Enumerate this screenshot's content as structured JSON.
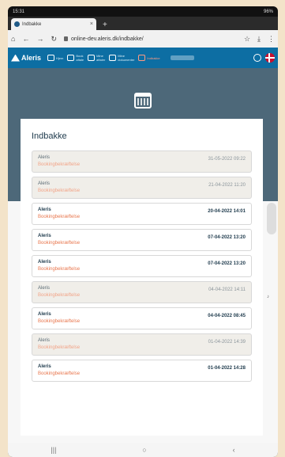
{
  "status": {
    "time": "15:31",
    "right": "96%"
  },
  "browser": {
    "tab_title": "Indbakke",
    "close": "×",
    "new_tab": "+",
    "url": "online-dev.aleris.dk/indbakke/"
  },
  "nav": {
    "logo": "Aleris",
    "items": [
      {
        "label": "Hjem",
        "icon": "heart-icon"
      },
      {
        "label": "Book\naftale",
        "icon": "calendar-icon"
      },
      {
        "label": "Mine\naftaler",
        "icon": "checklist-icon"
      },
      {
        "label": "Mine\ndokumenter",
        "icon": "document-icon"
      },
      {
        "label": "Indbakke",
        "icon": "mail-icon",
        "active": true
      }
    ]
  },
  "inbox": {
    "title": "Indbakke",
    "messages": [
      {
        "sender": "Aleris",
        "subject": "Bookingbekræftelse",
        "date": "31-05-2022 09:22",
        "read": true
      },
      {
        "sender": "Aleris",
        "subject": "Bookingbekræftelse",
        "date": "21-04-2022 11:20",
        "read": true
      },
      {
        "sender": "Aleris",
        "subject": "Bookingbekræftelse",
        "date": "20-04-2022 14:01",
        "read": false
      },
      {
        "sender": "Aleris",
        "subject": "Bookingbekræftelse",
        "date": "07-04-2022 13:20",
        "read": false
      },
      {
        "sender": "Aleris",
        "subject": "Bookingbekræftelse",
        "date": "07-04-2022 13:20",
        "read": false
      },
      {
        "sender": "Aleris",
        "subject": "Bookingbekræftelse",
        "date": "04-04-2022 14:11",
        "read": true
      },
      {
        "sender": "Aleris",
        "subject": "Bookingbekræftelse",
        "date": "04-04-2022 08:45",
        "read": false
      },
      {
        "sender": "Aleris",
        "subject": "Bookingbekræftelse",
        "date": "01-04-2022 14:39",
        "read": true
      },
      {
        "sender": "Aleris",
        "subject": "Bookingbekræftelse",
        "date": "01-04-2022 14:28",
        "read": false
      }
    ]
  },
  "colors": {
    "brand": "#0d6ea3",
    "accent": "#e8764d",
    "hero": "#4d6879"
  }
}
